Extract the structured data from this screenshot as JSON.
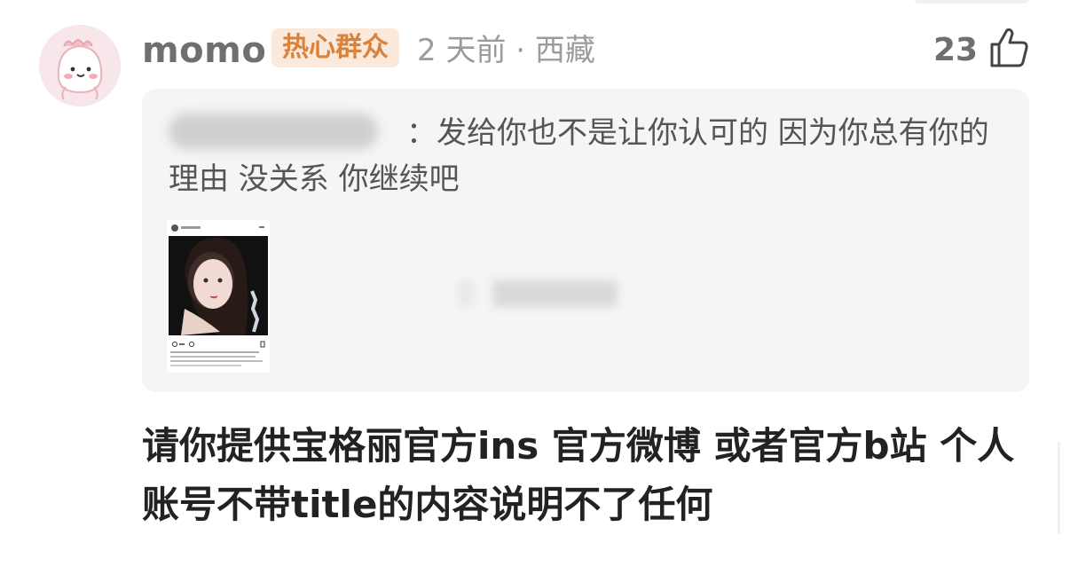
{
  "comment": {
    "username": "momo",
    "badge": "热心群众",
    "meta": "2 天前 · 西藏",
    "likes": "23",
    "icons": {
      "avatar": "cartoon-avatar",
      "like": "thumbs-up-icon"
    },
    "quote": {
      "text": "：发给你也不是让你认可的 因为你总有你的理由 没关系 你继续吧"
    },
    "body": "请你提供宝格丽官方ins 官方微博 或者官方b站 个人账号不带title的内容说明不了任何"
  },
  "colors": {
    "badge_bg": "#fbe9dc",
    "badge_text": "#d9823c",
    "quote_bg": "#f5f5f5"
  }
}
